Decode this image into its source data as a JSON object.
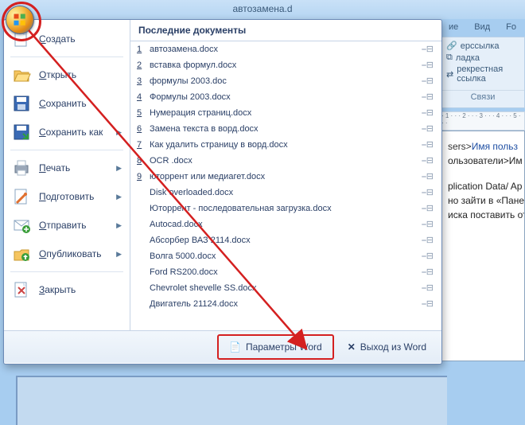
{
  "window_title": "автозамена.d",
  "ribbon": {
    "tabs": [
      "ие",
      "Вид",
      "Fo"
    ],
    "links_group": {
      "items": [
        "ерссылка",
        "ладка",
        "рекрестная ссылка"
      ],
      "caption": "Связи"
    }
  },
  "ruler_text": "· 1 · · · 2 · · · 3 · · · 4 · · · 5 · · ·",
  "doc_body": {
    "line1_grey": "sers>",
    "line1_blue": "Имя польз",
    "line2": "ользователи>Им",
    "line3": "plication Data/ Ap",
    "line4": "но зайти в «Пане",
    "line5": "иска поставить от"
  },
  "menu": {
    "left_items": [
      {
        "label": "Создать",
        "icon": "new"
      },
      {
        "label": "Открыть",
        "icon": "open"
      },
      {
        "label": "Сохранить",
        "icon": "save"
      },
      {
        "label": "Сохранить как",
        "icon": "saveas",
        "arrow": true
      },
      {
        "label": "Печать",
        "icon": "print",
        "arrow": true
      },
      {
        "label": "Подготовить",
        "icon": "prepare",
        "arrow": true
      },
      {
        "label": "Отправить",
        "icon": "send",
        "arrow": true
      },
      {
        "label": "Опубликовать",
        "icon": "publish",
        "arrow": true
      },
      {
        "label": "Закрыть",
        "icon": "close"
      }
    ],
    "recent_header": "Последние документы",
    "recent_docs": [
      {
        "n": "1",
        "name": "автозамена.docx"
      },
      {
        "n": "2",
        "name": "вставка формул.docx"
      },
      {
        "n": "3",
        "name": "формулы 2003.doc"
      },
      {
        "n": "4",
        "name": "Формулы 2003.docx"
      },
      {
        "n": "5",
        "name": "Нумерация страниц.docx"
      },
      {
        "n": "6",
        "name": "Замена текста в ворд.docx"
      },
      {
        "n": "7",
        "name": "Как удалить страницу в ворд.docx"
      },
      {
        "n": "8",
        "name": "OCR .docx"
      },
      {
        "n": "9",
        "name": "юторрент или медиагет.docx"
      },
      {
        "n": "",
        "name": "Disk overloaded.docx"
      },
      {
        "n": "",
        "name": "Юторрент - последовательная загрузка.docx"
      },
      {
        "n": "",
        "name": "Autocad.docx"
      },
      {
        "n": "",
        "name": "Абсорбер ВАЗ 2114.docx"
      },
      {
        "n": "",
        "name": "Волга 5000.docx"
      },
      {
        "n": "",
        "name": "Ford RS200.docx"
      },
      {
        "n": "",
        "name": "Chevrolet shevelle SS.docx"
      },
      {
        "n": "",
        "name": "Двигатель 21124.docx"
      }
    ],
    "footer": {
      "options_label": "Параметры Word",
      "exit_label": "Выход из Word"
    }
  },
  "orb_tooltip": "Office Button"
}
